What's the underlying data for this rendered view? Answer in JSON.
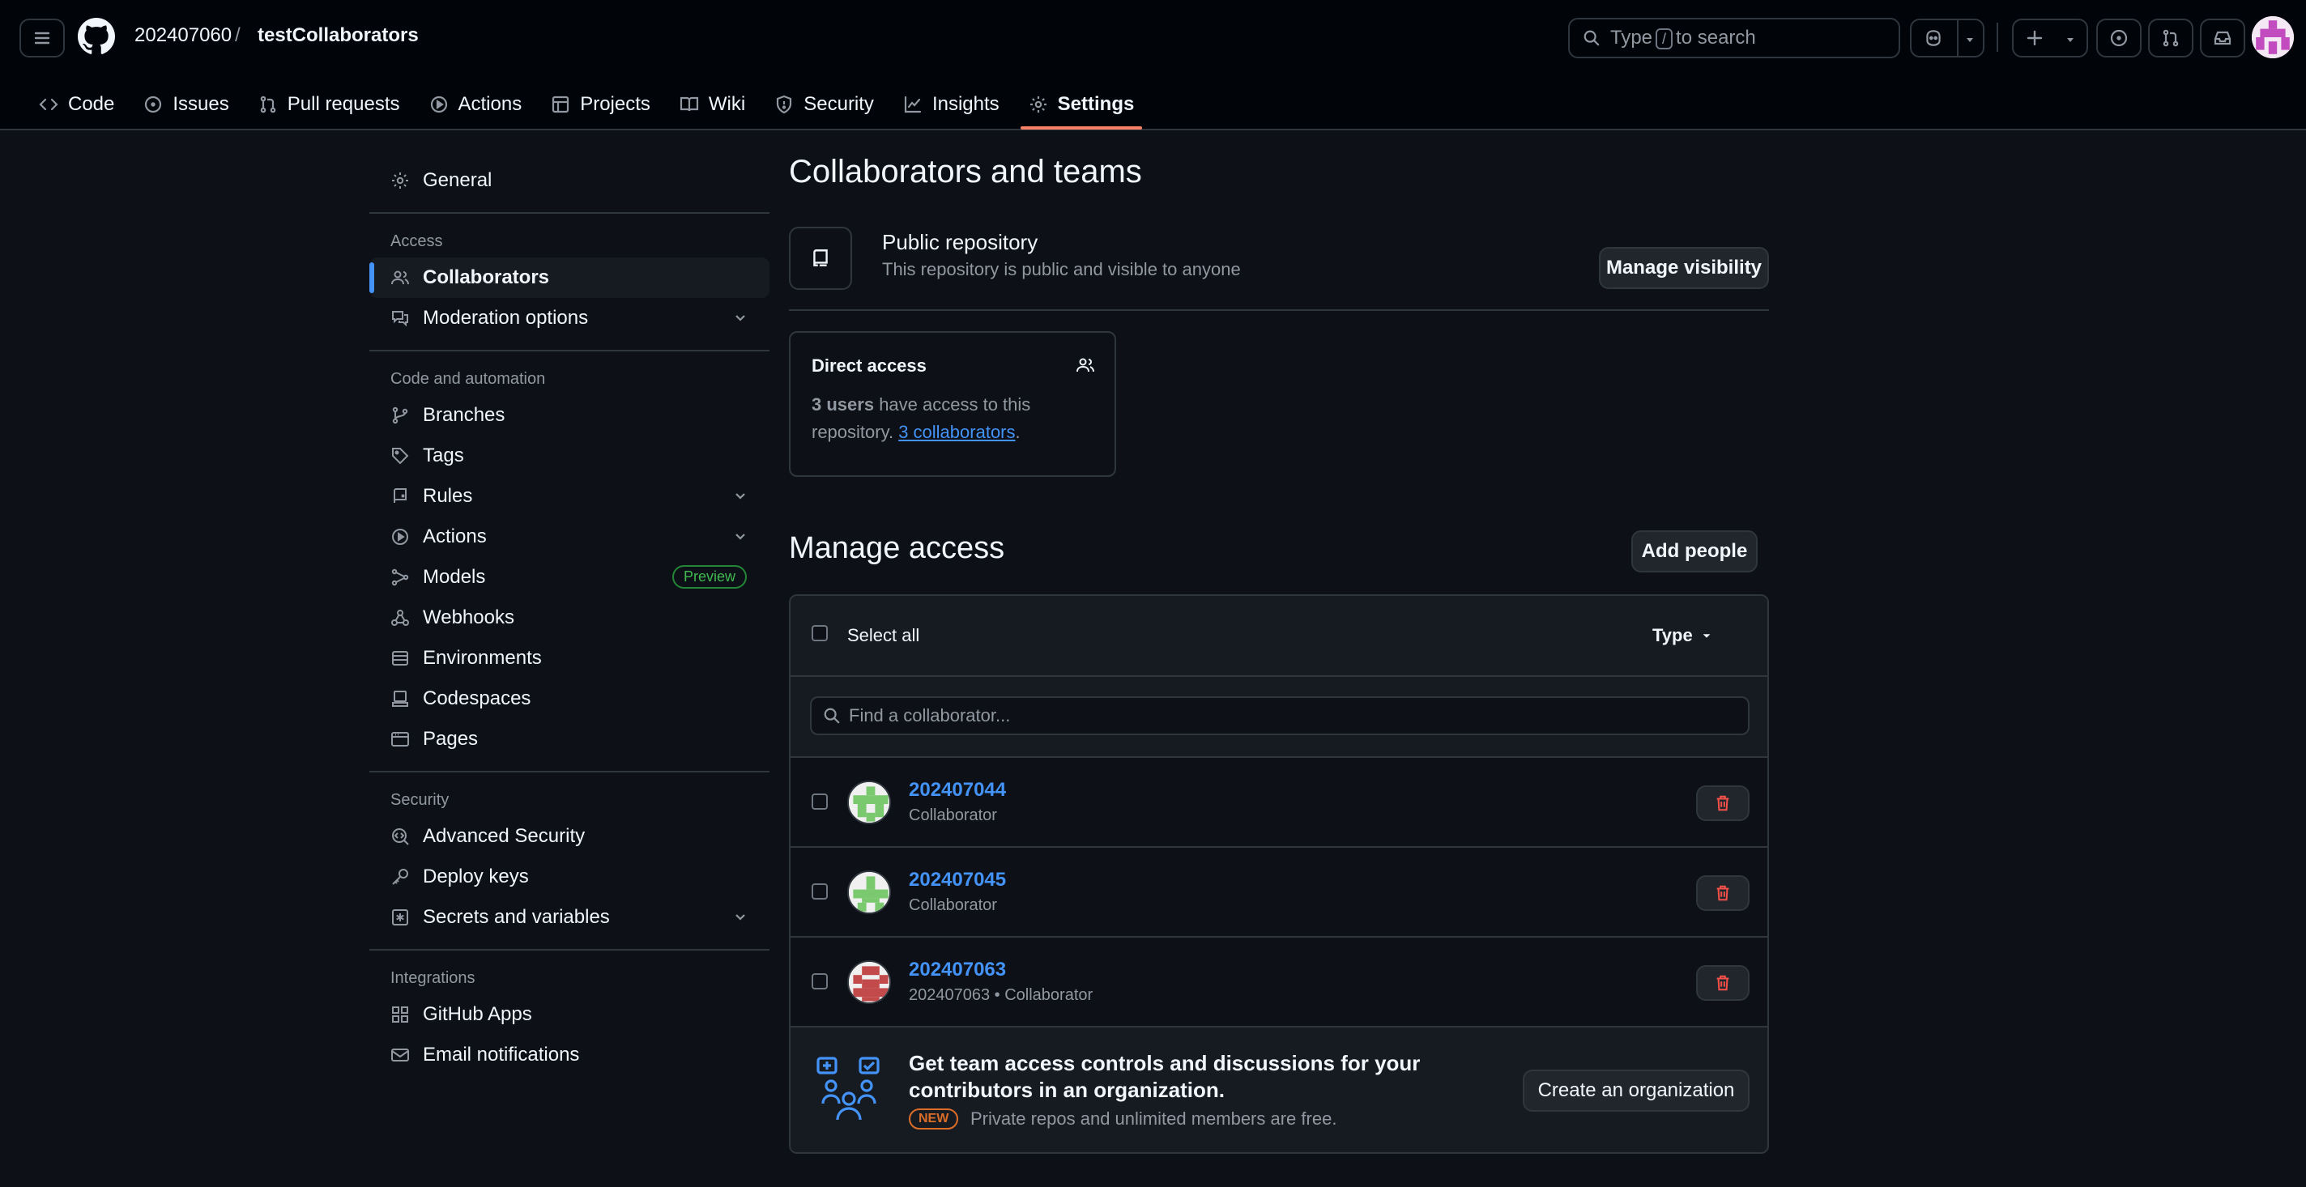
{
  "header": {
    "owner": "202407060",
    "separator": "/",
    "repo": "testCollaborators",
    "search": {
      "prefix": "Type",
      "key": "/",
      "suffix": "to search"
    }
  },
  "tabs": [
    {
      "label": "Code",
      "icon": "code-icon"
    },
    {
      "label": "Issues",
      "icon": "issue-icon"
    },
    {
      "label": "Pull requests",
      "icon": "pull-request-icon"
    },
    {
      "label": "Actions",
      "icon": "play-icon"
    },
    {
      "label": "Projects",
      "icon": "table-icon"
    },
    {
      "label": "Wiki",
      "icon": "book-icon"
    },
    {
      "label": "Security",
      "icon": "shield-icon"
    },
    {
      "label": "Insights",
      "icon": "graph-icon"
    },
    {
      "label": "Settings",
      "icon": "gear-icon",
      "active": true
    }
  ],
  "sidebar": {
    "general": "General",
    "access_heading": "Access",
    "collaborators": "Collaborators",
    "moderation": "Moderation options",
    "code_heading": "Code and automation",
    "branches": "Branches",
    "tags": "Tags",
    "rules": "Rules",
    "actions": "Actions",
    "models": "Models",
    "preview": "Preview",
    "webhooks": "Webhooks",
    "environments": "Environments",
    "codespaces": "Codespaces",
    "pages": "Pages",
    "security_heading": "Security",
    "advanced_security": "Advanced Security",
    "deploy_keys": "Deploy keys",
    "secrets": "Secrets and variables",
    "integrations_heading": "Integrations",
    "github_apps": "GitHub Apps",
    "email_notifications": "Email notifications"
  },
  "main": {
    "title": "Collaborators and teams",
    "visibility_title": "Public repository",
    "visibility_desc": "This repository is public and visible to anyone",
    "manage_visibility": "Manage visibility",
    "direct_access": {
      "title": "Direct access",
      "users": "3 users",
      "text1": "have access to this",
      "text2": "repository.",
      "link": "3 collaborators",
      "end": "."
    },
    "manage_access": "Manage access",
    "add_people": "Add people",
    "select_all": "Select all",
    "type": "Type",
    "find_placeholder": "Find a collaborator...",
    "collaborators": [
      {
        "name": "202407044",
        "role": "Collaborator",
        "color": "#7bc96f"
      },
      {
        "name": "202407045",
        "role": "Collaborator",
        "color": "#7bc96f"
      },
      {
        "name": "202407063",
        "role": "202407063 • Collaborator",
        "color": "#c34a4a"
      }
    ],
    "promo": {
      "title": "Get team access controls and discussions for your contributors in an organization.",
      "badge": "NEW",
      "desc": "Private repos and unlimited members are free.",
      "button": "Create an organization"
    }
  }
}
